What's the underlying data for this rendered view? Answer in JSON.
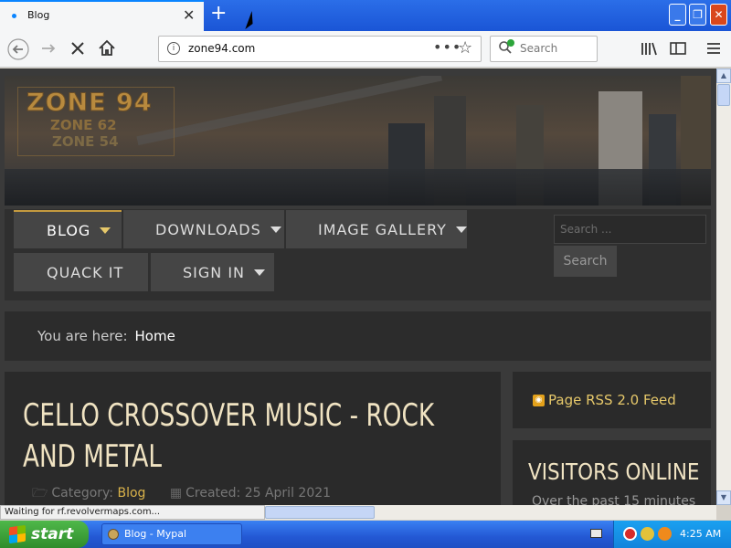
{
  "browser": {
    "tab_title": "Blog",
    "new_tab_label": "+",
    "url": "zone94.com",
    "search_placeholder": "Search",
    "status_text": "Waiting for rf.revolvermaps.com..."
  },
  "site": {
    "logo": {
      "main": "ZONE 94",
      "line2": "ZONE 62",
      "line3": "ZONE 54"
    },
    "menu": [
      {
        "label": "BLOG",
        "has_dropdown": true,
        "active": true
      },
      {
        "label": "DOWNLOADS",
        "has_dropdown": true
      },
      {
        "label": "IMAGE GALLERY",
        "has_dropdown": true
      },
      {
        "label": "QUACK IT",
        "has_dropdown": false
      },
      {
        "label": "SIGN IN",
        "has_dropdown": true
      }
    ],
    "search": {
      "placeholder": "Search ...",
      "button": "Search"
    },
    "breadcrumb": {
      "prefix": "You are here:",
      "current": "Home"
    },
    "article": {
      "title": "CELLO CROSSOVER MUSIC - ROCK AND METAL",
      "category_label": "Category:",
      "category_value": "Blog",
      "created": "Created: 25 April 2021"
    },
    "rss": {
      "label": "Page RSS 2.0 Feed"
    },
    "visitors": {
      "title": "VISITORS ONLINE",
      "subtitle": "Over the past 15 minutes"
    }
  },
  "taskbar": {
    "start_label": "start",
    "window_button": "Blog - Mypal",
    "clock": "4:25 AM"
  },
  "colors": {
    "accent": "#c49a3f",
    "link": "#d9b24a",
    "title": "#f0e3c2",
    "page_bg": "#3a3a3a"
  }
}
